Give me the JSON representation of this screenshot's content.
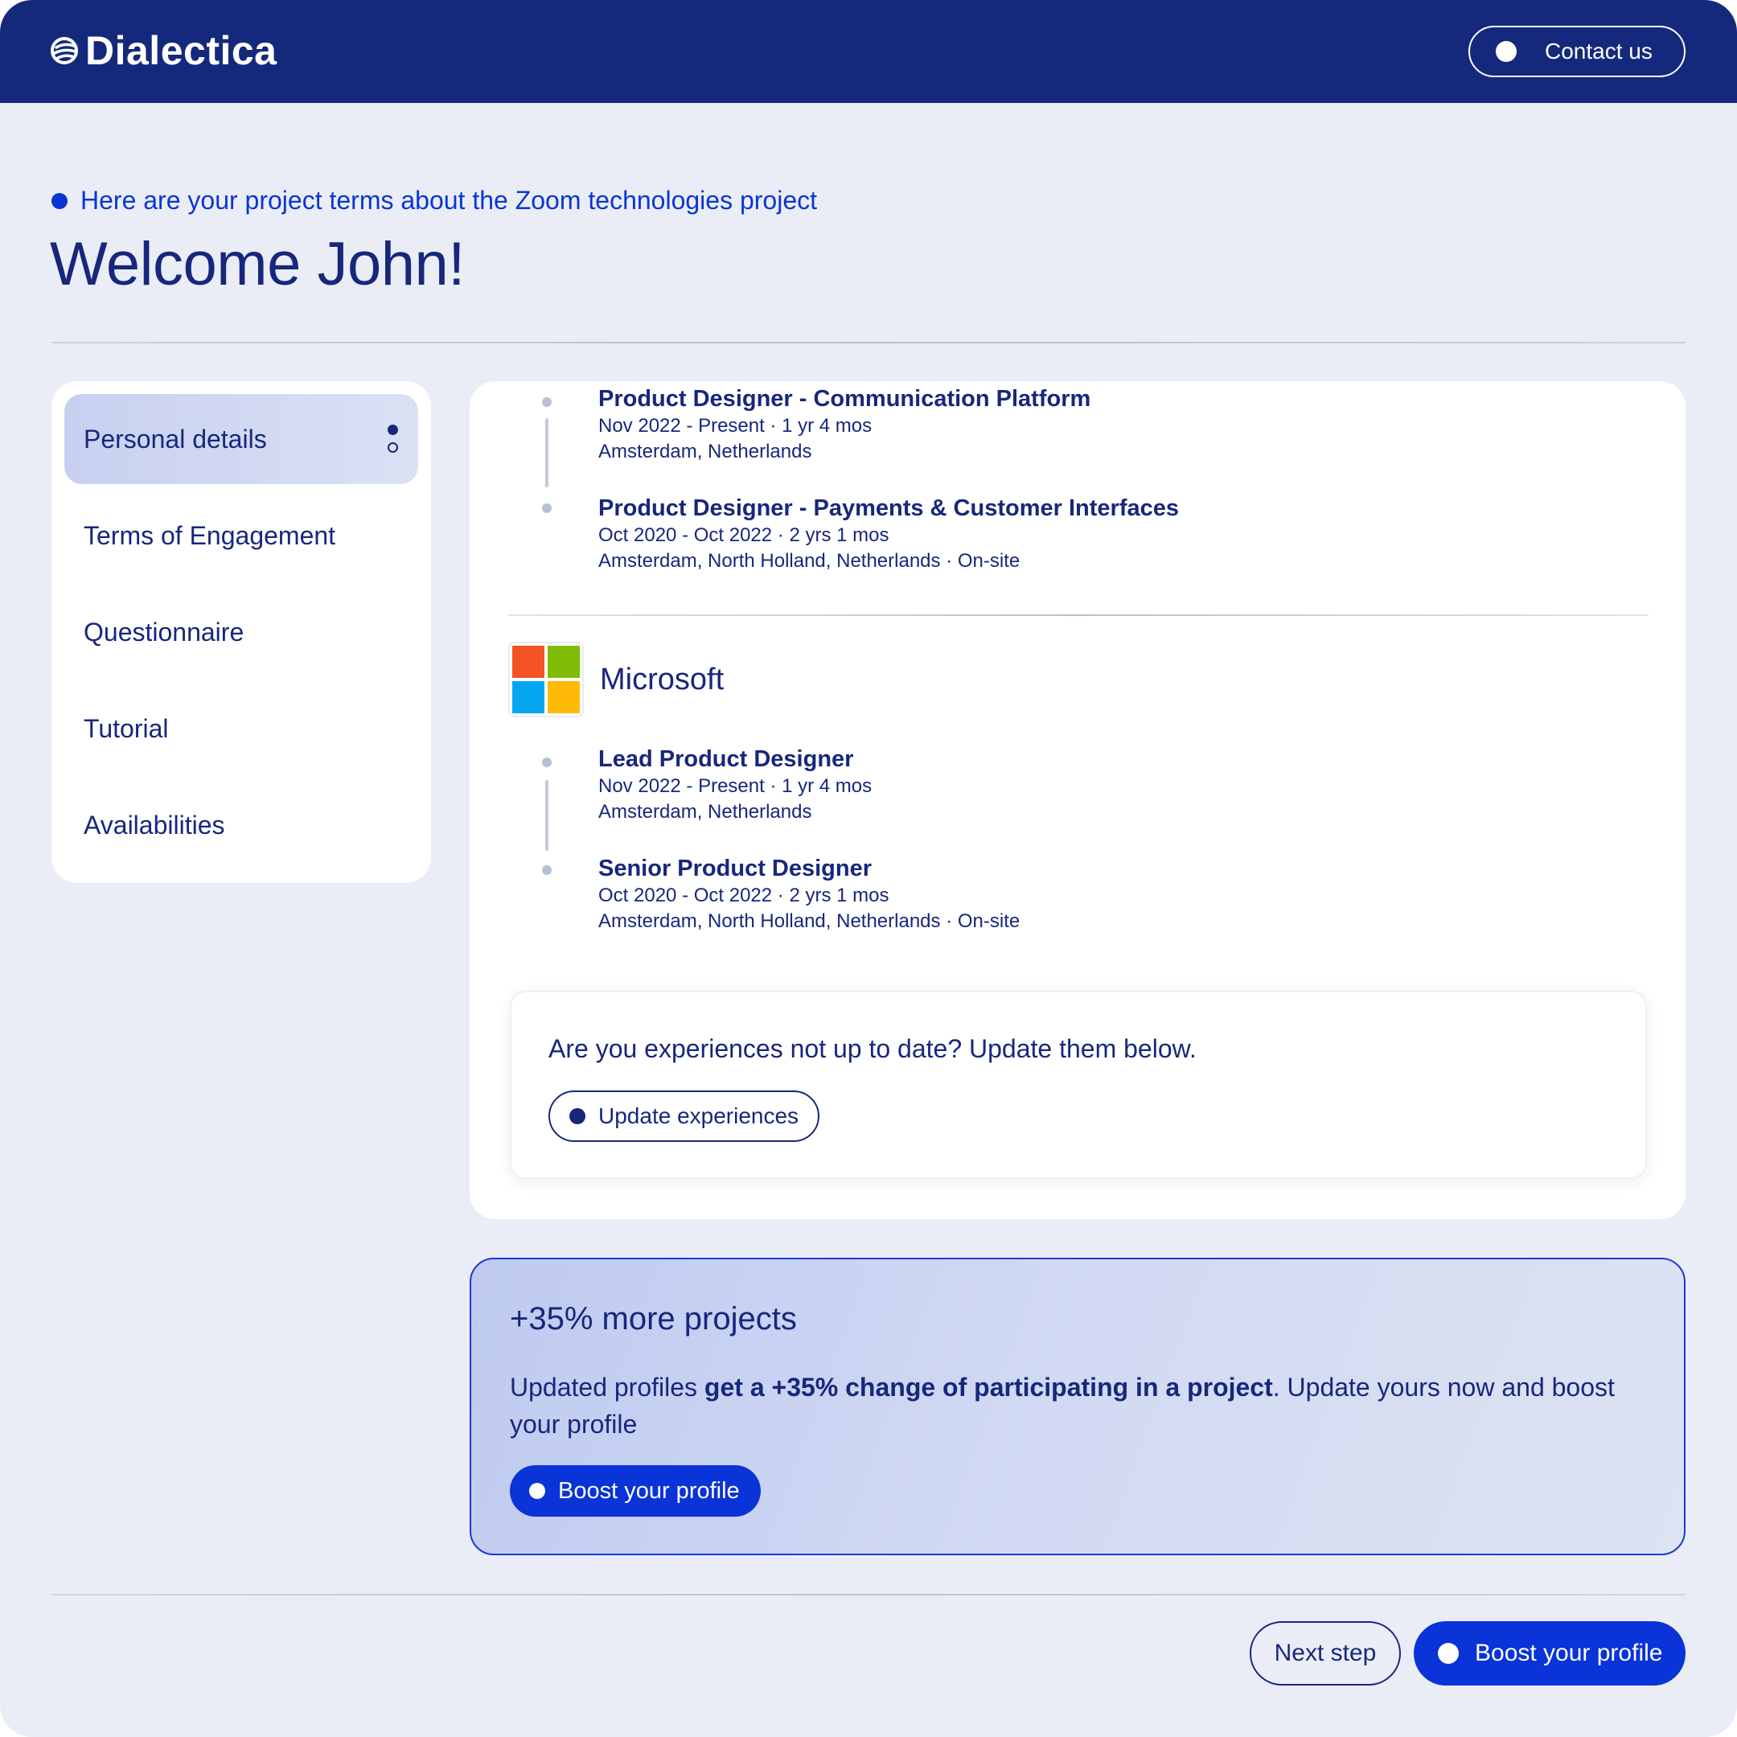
{
  "header": {
    "logo_text": "Dialectica",
    "contact_label": "Contact us"
  },
  "intro": {
    "eyebrow": "Here are your project terms about the Zoom technologies project",
    "title": "Welcome John!"
  },
  "sidebar": {
    "items": [
      {
        "label": "Personal details",
        "active": true
      },
      {
        "label": "Terms of Engagement",
        "active": false
      },
      {
        "label": "Questionnaire",
        "active": false
      },
      {
        "label": "Tutorial",
        "active": false
      },
      {
        "label": "Availabilities",
        "active": false
      }
    ]
  },
  "experience": {
    "previous_company_roles": [
      {
        "title": "Product Designer - Communication Platform",
        "dates": "Nov 2022 - Present · 1 yr 4 mos",
        "location": "Amsterdam, Netherlands"
      },
      {
        "title": "Product Designer - Payments & Customer Interfaces",
        "dates": "Oct 2020 - Oct 2022 · 2 yrs 1 mos",
        "location": "Amsterdam, North Holland, Netherlands · On-site"
      }
    ],
    "company": {
      "name": "Microsoft",
      "logo_colors": [
        "#f35325",
        "#81bc06",
        "#05a6f0",
        "#ffba08"
      ],
      "roles": [
        {
          "title": "Lead Product Designer",
          "dates": "Nov 2022 - Present · 1 yr 4 mos",
          "location": "Amsterdam, Netherlands"
        },
        {
          "title": "Senior Product Designer",
          "dates": "Oct 2020 - Oct 2022 · 2 yrs 1 mos",
          "location": "Amsterdam, North Holland, Netherlands · On-site"
        }
      ]
    },
    "update_prompt": "Are you experiences not up to date? Update them below.",
    "update_button": "Update experiences"
  },
  "promo": {
    "title": "+35% more projects",
    "text_start": "Updated profiles ",
    "text_bold": "get a +35% change of participating in a project",
    "text_end": ".  Update yours now and boost your profile",
    "button": "Boost your profile"
  },
  "footer": {
    "next_label": "Next step",
    "boost_label": "Boost your profile"
  },
  "colors": {
    "navy": "#15297c",
    "accent_blue": "#0a33d8",
    "background": "#eaedf5"
  }
}
